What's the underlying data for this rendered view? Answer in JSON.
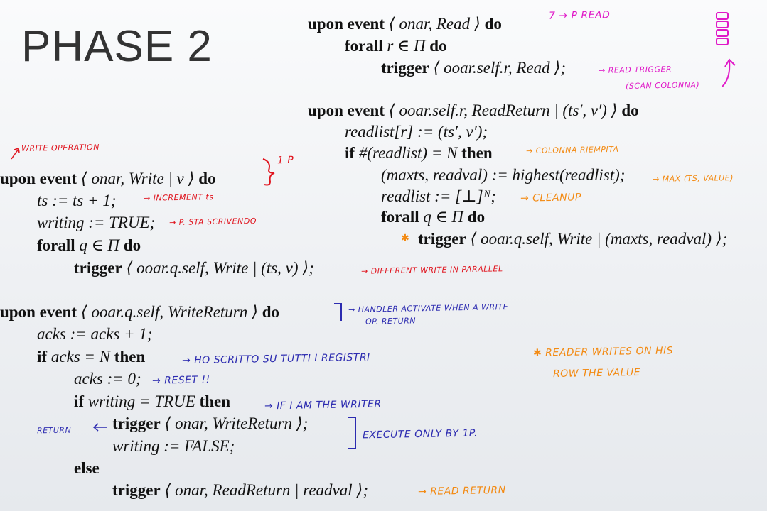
{
  "title": "PHASE 2",
  "read_code": [
    {
      "kw1": "upon event",
      "txt": " ⟨ onar, Read ⟩ ",
      "kw2": "do"
    },
    {
      "kw1": "forall",
      "txt": " r ∈ Π ",
      "kw2": "do"
    },
    {
      "kw1": "trigger",
      "txt": " ⟨ ooar.self.r, Read ⟩;",
      "kw2": ""
    },
    {
      "kw1": "upon event",
      "txt": " ⟨ ooar.self.r, ReadReturn | (ts′, v′) ⟩ ",
      "kw2": "do"
    },
    {
      "kw1": "",
      "txt": "readlist[r] := (ts′, v′);",
      "kw2": ""
    },
    {
      "kw1": "if",
      "txt": " #(readlist) = N ",
      "kw2": "then"
    },
    {
      "kw1": "",
      "txt": "(maxts, readval) := highest(readlist);",
      "kw2": ""
    },
    {
      "kw1": "",
      "txt": "readlist := [⊥]ᴺ;",
      "kw2": ""
    },
    {
      "kw1": "forall",
      "txt": " q ∈ Π ",
      "kw2": "do"
    },
    {
      "kw1": "trigger",
      "txt": " ⟨ ooar.q.self, Write | (maxts, readval) ⟩;",
      "kw2": ""
    }
  ],
  "write_code": [
    {
      "kw1": "upon event",
      "txt": " ⟨ onar, Write | v ⟩ ",
      "kw2": "do"
    },
    {
      "kw1": "",
      "txt": "ts := ts + 1;",
      "kw2": ""
    },
    {
      "kw1": "",
      "txt": "writing := TRUE;",
      "kw2": ""
    },
    {
      "kw1": "forall",
      "txt": " q ∈ Π ",
      "kw2": "do"
    },
    {
      "kw1": "trigger",
      "txt": " ⟨ ooar.q.self, Write | (ts, v) ⟩;",
      "kw2": ""
    }
  ],
  "return_code": [
    {
      "kw1": "upon event",
      "txt": " ⟨ ooar.q.self, WriteReturn ⟩ ",
      "kw2": "do"
    },
    {
      "kw1": "",
      "txt": "acks := acks + 1;",
      "kw2": ""
    },
    {
      "kw1": "if",
      "txt": " acks = N ",
      "kw2": "then"
    },
    {
      "kw1": "",
      "txt": "acks := 0;",
      "kw2": ""
    },
    {
      "kw1": "if",
      "txt": " writing = TRUE ",
      "kw2": "then"
    },
    {
      "kw1": "trigger",
      "txt": " ⟨ onar, WriteReturn ⟩;",
      "kw2": ""
    },
    {
      "kw1": "",
      "txt": "writing := FALSE;",
      "kw2": ""
    },
    {
      "kw1": "else",
      "txt": "",
      "kw2": ""
    },
    {
      "kw1": "trigger",
      "txt": " ⟨ onar, ReadReturn | readval ⟩;",
      "kw2": ""
    }
  ],
  "annotations": {
    "p_read": "7 → P READ",
    "read_trigger_1": "→ READ TRIGGER",
    "read_trigger_2": "(SCAN COLONNA)",
    "colonna_riempita": "→ COLONNA RIEMPITA",
    "max": "→ MAX (TS, VALUE)",
    "cleanup": "→ CLEANUP",
    "write_operation": "WRITE OPERATION",
    "one_p": "1 P",
    "increment_ts": "→ INCREMENT ts",
    "p_sta_scrivendo": "→ P. STA SCRIVENDO",
    "different_write": "→ DIFFERENT WRITE IN PARALLEL",
    "handler_1": "→ HANDLER ACTIVATE WHEN A WRITE",
    "handler_2": "OP. RETURN",
    "ho_scritto": "→ HO SCRITTO SU TUTTI I REGISTRI",
    "reset": "→ RESET !!",
    "if_writer": "→ IF I AM THE WRITER",
    "return": "RETURN",
    "execute_only": "EXECUTE ONLY BY 1P.",
    "reader_1": "✱ READER WRITES ON HIS",
    "reader_2": "ROW THE VALUE",
    "read_return": "→ READ RETURN",
    "star": "✱"
  },
  "colors": {
    "red": "#e0141e",
    "blue": "#2c2bb0",
    "orange": "#f38a12",
    "magenta": "#e01ac8"
  }
}
